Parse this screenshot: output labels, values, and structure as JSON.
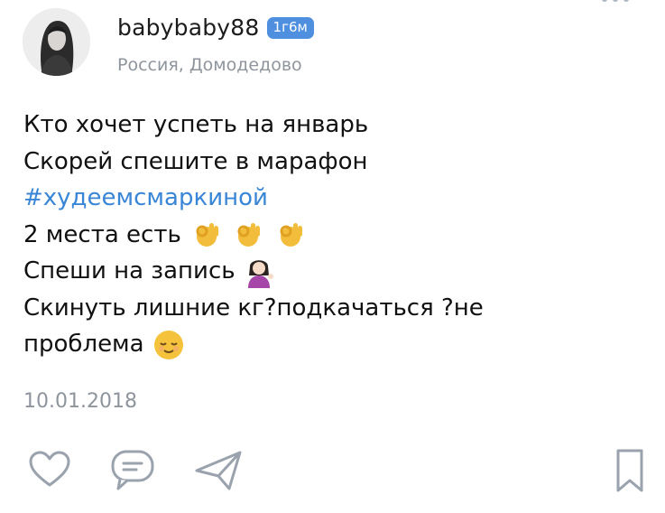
{
  "post": {
    "author": {
      "username": "babybaby88",
      "time_badge": "1г6м",
      "location": "Россия, Домодедово"
    },
    "lines": [
      "Кто хочет успеть на январь",
      "Скорей спешите в марафон",
      "#худеемсмаркиной",
      "2 места есть",
      "Спеши на запись",
      "Скинуть лишние кг?подкачаться ?не",
      "проблема"
    ],
    "date": "10.01.2018"
  },
  "icons": {
    "more": "more-dots-icon",
    "like": "heart-icon",
    "comment": "comment-icon",
    "share": "send-icon",
    "bookmark": "bookmark-icon",
    "emoji_ok": "ok-hand-emoji",
    "emoji_tipping": "tipping-hand-woman-emoji",
    "emoji_relieved": "relieved-face-emoji"
  },
  "colors": {
    "accent": "#3a86d6",
    "badge": "#4f8fe0",
    "secondary_text": "#8e959d",
    "icon_gray": "#9aa3ad"
  }
}
